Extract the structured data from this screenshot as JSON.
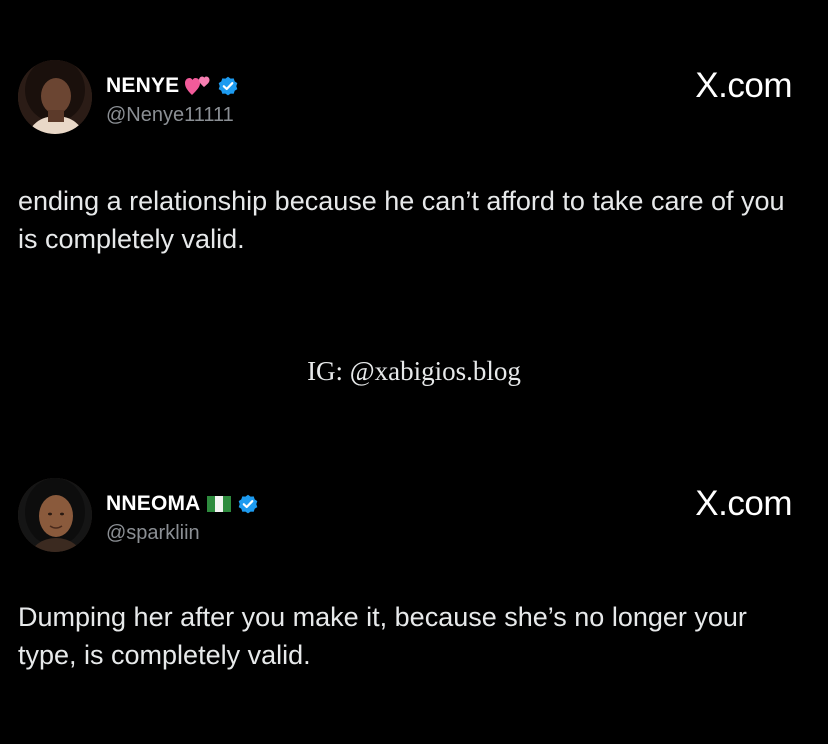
{
  "tweets": [
    {
      "display_name": "NENYE",
      "name_emoji": "pink-hearts-emoji",
      "verified": true,
      "handle": "@Nenye11111",
      "brand": "X.com",
      "text": "ending a relationship because he can’t afford to take care of you is completely valid."
    },
    {
      "display_name": "NNEOMA",
      "name_emoji": "nigeria-flag",
      "verified": true,
      "handle": "@sparkliin",
      "brand": "X.com",
      "text": "Dumping her after you make it, because she’s no longer your type, is completely valid."
    }
  ],
  "watermark": "IG: @xabigios.blog",
  "colors": {
    "background": "#000000",
    "text": "#e7e9ea",
    "handle": "#8b8f94",
    "verified": "#1d9bf0",
    "heart": "#f25b9a",
    "flag_green": "#2e8b3e"
  }
}
